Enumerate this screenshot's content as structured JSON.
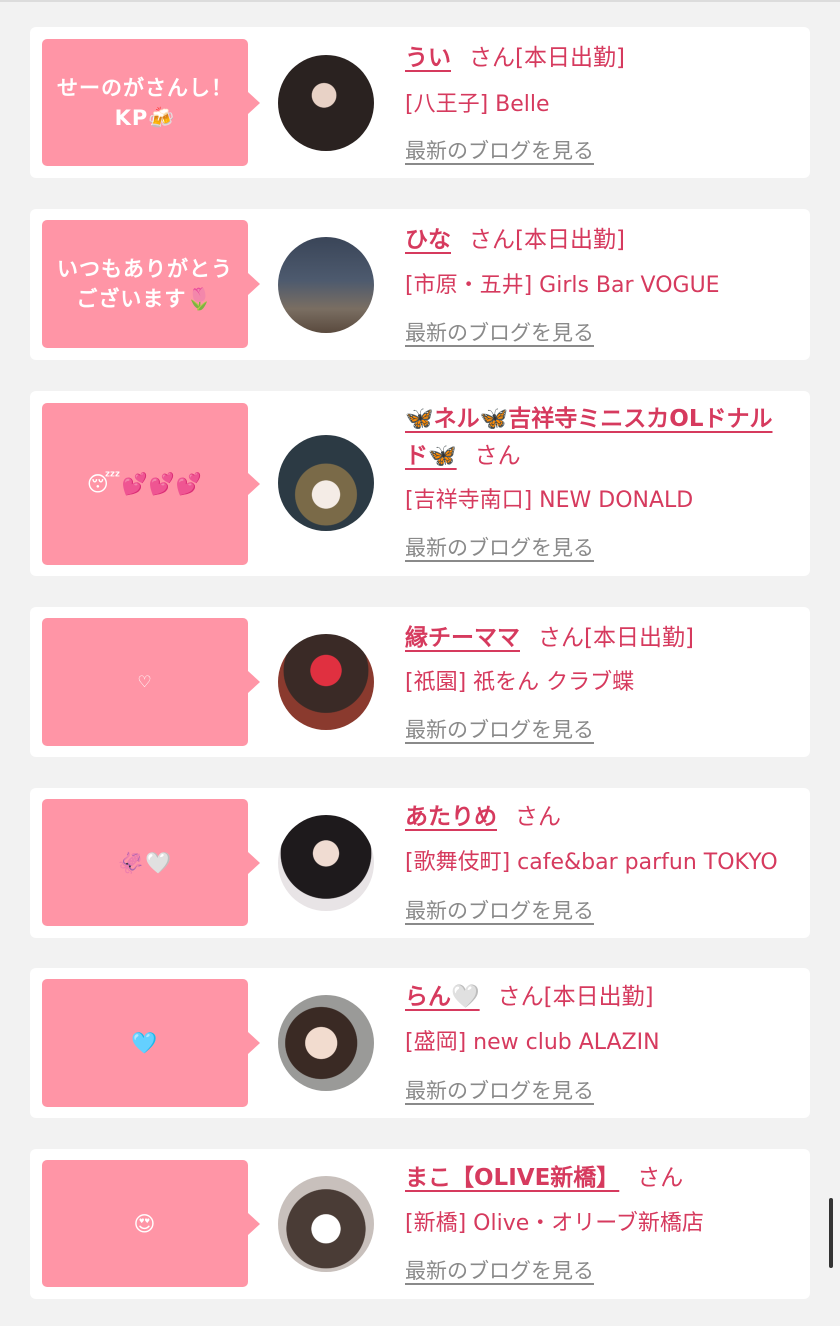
{
  "colors": {
    "background": "#f2f2f2",
    "card": "#ffffff",
    "bubble": "#ff95a6",
    "name_text": "#d63a5e",
    "link_text": "#8a8a8a"
  },
  "items": [
    {
      "message": "せーのがさんし！\nKP🍻",
      "name": "うい",
      "suffix": "さん[本日出勤]",
      "shop": "[八王子] Belle",
      "blog_link": "最新のブログを見る"
    },
    {
      "message": "いつもありがとう\nございます🌷",
      "name": "ひな",
      "suffix": "さん[本日出勤]",
      "shop": "[市原・五井] Girls Bar VOGUE",
      "blog_link": "最新のブログを見る"
    },
    {
      "message": "😴💕💕💕",
      "name": "🦋ネル🦋吉祥寺ミニスカOLドナルド🦋",
      "suffix": "さん",
      "shop": "[吉祥寺南口] NEW DONALD",
      "blog_link": "最新のブログを見る"
    },
    {
      "message": "♡",
      "name": "縁チーママ",
      "suffix": "さん[本日出勤]",
      "shop": "[祇園] 祇をん クラブ蝶",
      "blog_link": "最新のブログを見る"
    },
    {
      "message": "🦑🤍",
      "name": "あたりめ",
      "suffix": "さん",
      "shop": "[歌舞伎町] cafe&bar parfun TOKYO",
      "blog_link": "最新のブログを見る"
    },
    {
      "message": "🩵",
      "name": "らん🤍",
      "suffix": "さん[本日出勤]",
      "shop": "[盛岡] new club ALAZIN",
      "blog_link": "最新のブログを見る"
    },
    {
      "message": "😍",
      "name": "まこ【OLIVE新橋】",
      "suffix": "さん",
      "shop": "[新橋] Olive・オリーブ新橋店",
      "blog_link": "最新のブログを見る"
    }
  ]
}
